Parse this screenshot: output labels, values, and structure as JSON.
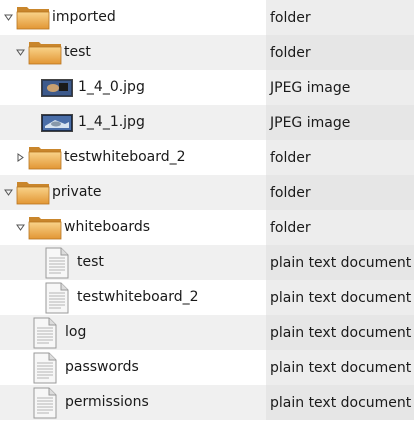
{
  "rows": [
    {
      "name": "imported",
      "type": "folder",
      "kind": "folder",
      "expander": "expanded"
    },
    {
      "name": "test",
      "type": "folder",
      "kind": "folder",
      "expander": "expanded"
    },
    {
      "name": "1_4_0.jpg",
      "type": "JPEG image",
      "kind": "image",
      "expander": "none"
    },
    {
      "name": "1_4_1.jpg",
      "type": "JPEG image",
      "kind": "image",
      "expander": "none"
    },
    {
      "name": "testwhiteboard_2",
      "type": "folder",
      "kind": "folder",
      "expander": "collapsed"
    },
    {
      "name": "private",
      "type": "folder",
      "kind": "folder",
      "expander": "expanded"
    },
    {
      "name": "whiteboards",
      "type": "folder",
      "kind": "folder",
      "expander": "expanded"
    },
    {
      "name": "test",
      "type": "plain text document",
      "kind": "text",
      "expander": "none"
    },
    {
      "name": "testwhiteboard_2",
      "type": "plain text document",
      "kind": "text",
      "expander": "none"
    },
    {
      "name": "log",
      "type": "plain text document",
      "kind": "text",
      "expander": "none"
    },
    {
      "name": "passwords",
      "type": "plain text document",
      "kind": "text",
      "expander": "none"
    },
    {
      "name": "permissions",
      "type": "plain text document",
      "kind": "text",
      "expander": "none"
    }
  ],
  "icons": {
    "folder": "folder-icon",
    "image": "image-file-icon",
    "text": "text-document-icon",
    "expanded": "expander-expanded-icon",
    "collapsed": "expander-collapsed-icon"
  },
  "colors": {
    "folder_body": "#e8a040",
    "folder_light": "#f7c978",
    "row_alt": "#f0f0f0",
    "type_column": "#ededed"
  }
}
